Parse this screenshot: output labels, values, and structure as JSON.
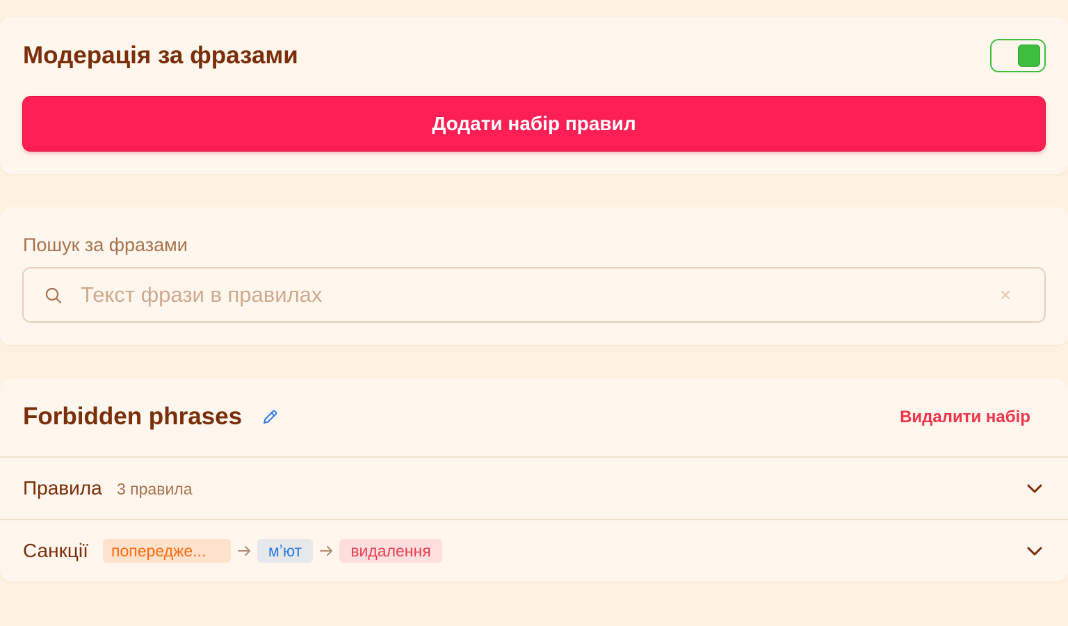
{
  "moderation": {
    "title": "Модерація за фразами",
    "enabled": true,
    "add_button_label": "Додати набір правил"
  },
  "search": {
    "label": "Пошук за фразами",
    "placeholder": "Текст фрази в правилах",
    "value": "",
    "clear_icon": "close-icon",
    "clear_glyph": "×"
  },
  "ruleset": {
    "title": "Forbidden phrases",
    "delete_label": "Видалити набір",
    "rules": {
      "label": "Правила",
      "count_text": "3 правила"
    },
    "sanctions": {
      "label": "Санкції",
      "steps": [
        {
          "label": "попередже...",
          "color": "#FF6A10"
        },
        {
          "label": "мʼют",
          "color": "#2C7BE5"
        },
        {
          "label": "видалення",
          "color": "#E8404F"
        }
      ]
    }
  },
  "colors": {
    "background": "#FFF1E0",
    "card": "#FFF7ED",
    "primary": "#FF1F55",
    "title_text": "#7A2E0A",
    "toggle_on": "#3DBE3D",
    "danger": "#F0334A"
  }
}
